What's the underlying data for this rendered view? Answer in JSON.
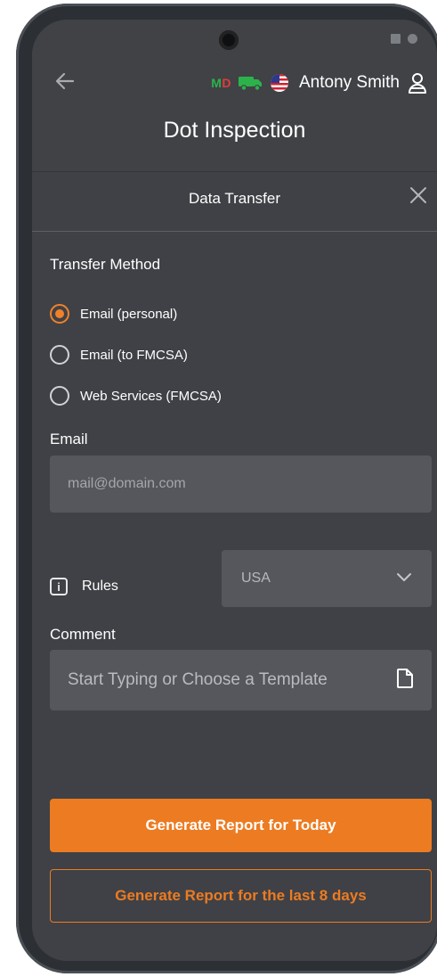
{
  "header": {
    "badge_m": "M",
    "badge_d": "D",
    "user_name": "Antony Smith",
    "title": "Dot Inspection"
  },
  "modal": {
    "title": "Data Transfer",
    "transfer_method_label": "Transfer Method",
    "options": [
      {
        "label": "Email (personal)",
        "selected": true
      },
      {
        "label": "Email (to FMCSA)",
        "selected": false
      },
      {
        "label": "Web Services (FMCSA)",
        "selected": false
      }
    ],
    "email_label": "Email",
    "email_placeholder": "mail@domain.com",
    "email_value": "",
    "rules_label": "Rules",
    "rules_info_glyph": "i",
    "rules_value": "USA",
    "comment_label": "Comment",
    "comment_placeholder": "Start Typing or Choose a Template",
    "primary_button": "Generate Report for Today",
    "secondary_button": "Generate Report for the last 8 days"
  },
  "colors": {
    "accent": "#ec7b22",
    "background": "#3f4146",
    "input": "#55575c"
  }
}
